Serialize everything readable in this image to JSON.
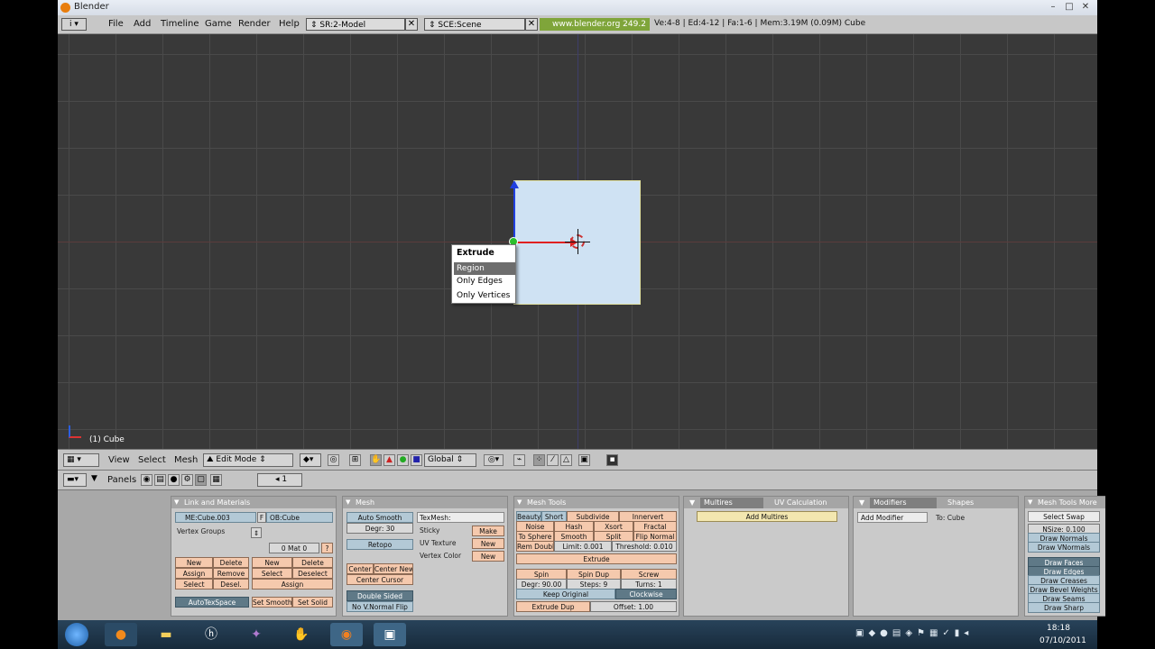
{
  "window": {
    "title": "Blender",
    "controls": [
      "–",
      "□",
      "✕"
    ]
  },
  "infobar": {
    "menus": [
      "File",
      "Add",
      "Timeline",
      "Game",
      "Render",
      "Help"
    ],
    "screen_field": "SR:2-Model",
    "scene_field": "SCE:Scene",
    "url": "www.blender.org 249.2",
    "stats": "Ve:4-8 | Ed:4-12 | Fa:1-6 | Mem:3.19M (0.09M) Cube"
  },
  "viewport": {
    "object_label": "(1) Cube",
    "popup": {
      "title": "Extrude",
      "items": [
        "Region",
        "Only Edges",
        "Only Vertices"
      ],
      "selected_index": 0
    }
  },
  "view_header": {
    "menus": [
      "View",
      "Select",
      "Mesh"
    ],
    "mode": "Edit Mode",
    "orientation": "Global"
  },
  "buttons_header": {
    "label": "Panels",
    "frame": "1"
  },
  "panels": {
    "link": {
      "title": "Link and Materials",
      "me": "ME:Cube.003",
      "f": "F",
      "ob": "OB:Cube",
      "vertex_groups": "Vertex Groups",
      "mat": "0 Mat 0",
      "q": "?",
      "vg_buttons": [
        "New",
        "Delete",
        "Assign",
        "Remove",
        "Select",
        "Desel."
      ],
      "mat_buttons": [
        "New",
        "Delete",
        "Select",
        "Deselect",
        "Assign"
      ],
      "autotex": "AutoTexSpace",
      "set_smooth": "Set Smooth",
      "set_solid": "Set Solid"
    },
    "mesh": {
      "title": "Mesh",
      "auto_smooth": "Auto Smooth",
      "degr": "Degr: 30",
      "retopo": "Retopo",
      "center": "Center",
      "center_new": "Center New",
      "center_cursor": "Center Cursor",
      "double_sided": "Double Sided",
      "no_vnormal_flip": "No V.Normal Flip",
      "texmesh": "TexMesh:",
      "sticky": "Sticky",
      "make": "Make",
      "uv_texture": "UV Texture",
      "new": "New",
      "vertex_color": "Vertex Color",
      "new2": "New"
    },
    "mesh_tools": {
      "title": "Mesh Tools",
      "row1": [
        "Beauty",
        "Short",
        "Subdivide",
        "Innervert"
      ],
      "row2": [
        "Noise",
        "Hash",
        "Xsort",
        "Fractal"
      ],
      "row3": [
        "To Sphere",
        "Smooth",
        "Split",
        "Flip Normal"
      ],
      "row4": [
        "Rem Doubl",
        "Limit: 0.001",
        "Threshold: 0.010"
      ],
      "extrude": "Extrude",
      "row5": [
        "Spin",
        "Spin Dup",
        "Screw"
      ],
      "row6": [
        "Degr: 90.00",
        "Steps: 9",
        "Turns: 1"
      ],
      "keep_original": "Keep Original",
      "clockwise": "Clockwise",
      "extrude_dup": "Extrude Dup",
      "offset": "Offset: 1.00"
    },
    "multires": {
      "tab1": "Multires",
      "tab2": "UV Calculation",
      "add": "Add Multires"
    },
    "modifiers": {
      "tab1": "Modifiers",
      "tab2": "Shapes",
      "add": "Add Modifier",
      "to": "To: Cube"
    },
    "mesh_tools_more": {
      "title": "Mesh Tools More",
      "select_swap": "Select Swap",
      "nsize": "NSize: 0.100",
      "draw_normals": "Draw Normals",
      "draw_vnormals": "Draw VNormals",
      "draw_items": [
        "Draw Faces",
        "Draw Edges",
        "Draw Creases",
        "Draw Bevel Weights",
        "Draw Seams",
        "Draw Sharp"
      ]
    }
  },
  "taskbar": {
    "time": "18:18",
    "date": "07/10/2011"
  },
  "colors": {
    "viewport_bg": "#393939",
    "grid": "#4a4a4a",
    "face": "#cfe2f3",
    "header": "#c4c4c4"
  }
}
